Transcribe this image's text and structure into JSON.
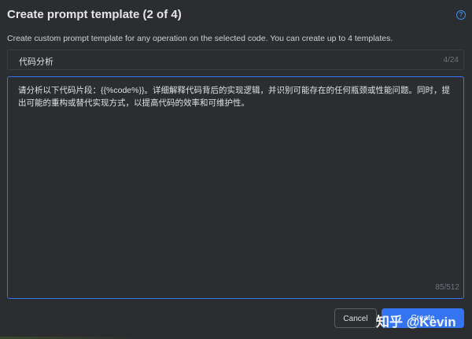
{
  "dialog": {
    "title": "Create prompt template (2 of 4)",
    "help_icon": "help-circle-icon",
    "description": "Create custom prompt template for any operation on the selected code. You can create up to 4 templates."
  },
  "name_field": {
    "value": "代码分析",
    "counter": "4/24"
  },
  "prompt_field": {
    "value": "请分析以下代码片段：{{%code%}}。详细解释代码背后的实现逻辑，并识别可能存在的任何瓶颈或性能问题。同时，提出可能的重构或替代实现方式，以提高代码的效率和可维护性。",
    "counter": "85/512"
  },
  "buttons": {
    "cancel": "Cancel",
    "save": "Create"
  },
  "watermark": "知乎 @Kevin",
  "colors": {
    "background": "#2b2d30",
    "accent": "#3574f0",
    "border": "#393b40"
  }
}
